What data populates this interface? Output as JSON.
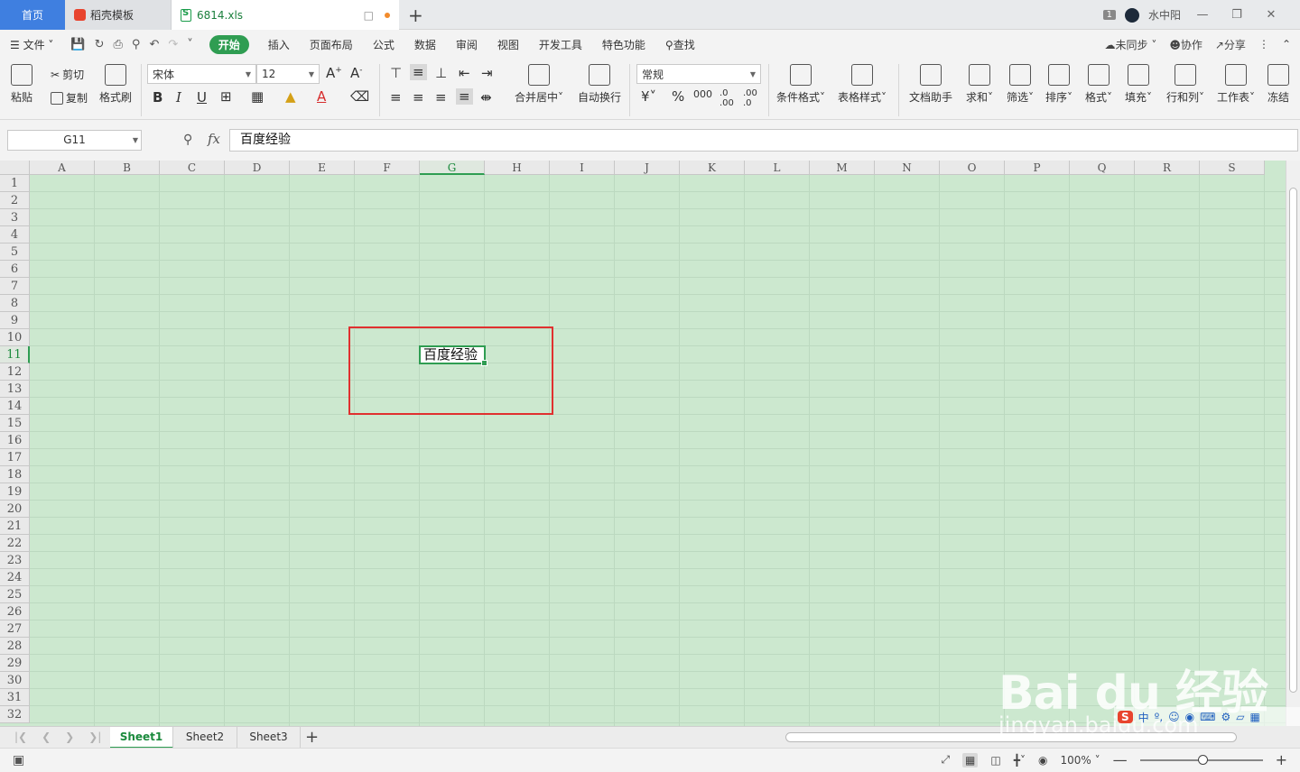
{
  "titlebar": {
    "tabs": [
      {
        "label": "首页"
      },
      {
        "label": "稻壳模板"
      },
      {
        "label": "6814.xls"
      }
    ],
    "new_tab": "+",
    "badge": "1",
    "user": "水中阳"
  },
  "menu": {
    "file": "文件",
    "tabs": [
      "开始",
      "插入",
      "页面布局",
      "公式",
      "数据",
      "审阅",
      "视图",
      "开发工具",
      "特色功能"
    ],
    "search": "查找",
    "sync": "未同步",
    "collab": "协作",
    "share": "分享"
  },
  "ribbon": {
    "paste": "粘贴",
    "cut": "剪切",
    "copy": "复制",
    "format_painter": "格式刷",
    "font_name": "宋体",
    "font_size": "12",
    "merge_center": "合并居中",
    "wrap_text": "自动换行",
    "number_format": "常规",
    "conditional_format": "条件格式",
    "table_style": "表格样式",
    "doc_assistant": "文档助手",
    "sum": "求和",
    "filter": "筛选",
    "sort": "排序",
    "format": "格式",
    "fill": "填充",
    "row_col": "行和列",
    "worksheet": "工作表",
    "freeze": "冻结"
  },
  "formula": {
    "cell_ref": "G11",
    "fx": "fx",
    "content": "百度经验"
  },
  "grid": {
    "columns": [
      "A",
      "B",
      "C",
      "D",
      "E",
      "F",
      "G",
      "H",
      "I",
      "J",
      "K",
      "L",
      "M",
      "N",
      "O",
      "P",
      "Q",
      "R",
      "S"
    ],
    "rows": [
      "1",
      "2",
      "3",
      "4",
      "5",
      "6",
      "7",
      "8",
      "9",
      "10",
      "11",
      "12",
      "13",
      "14",
      "15",
      "16",
      "17",
      "18",
      "19",
      "20",
      "21",
      "22",
      "23",
      "24",
      "25",
      "26",
      "27",
      "28",
      "29",
      "30",
      "31",
      "32"
    ],
    "selected_col": "G",
    "selected_row": "11",
    "active_value": "百度经验",
    "colors": {
      "cell_bg": "#cce8cf",
      "accent": "#2f9d52",
      "highlight": "#e0302f"
    }
  },
  "sheets": [
    "Sheet1",
    "Sheet2",
    "Sheet3"
  ],
  "status": {
    "zoom": "100%"
  },
  "watermark": {
    "text": "Bai du 经验",
    "url": "jingyan.baidu.com"
  },
  "ime": {
    "items": [
      "中",
      "º,"
    ]
  }
}
